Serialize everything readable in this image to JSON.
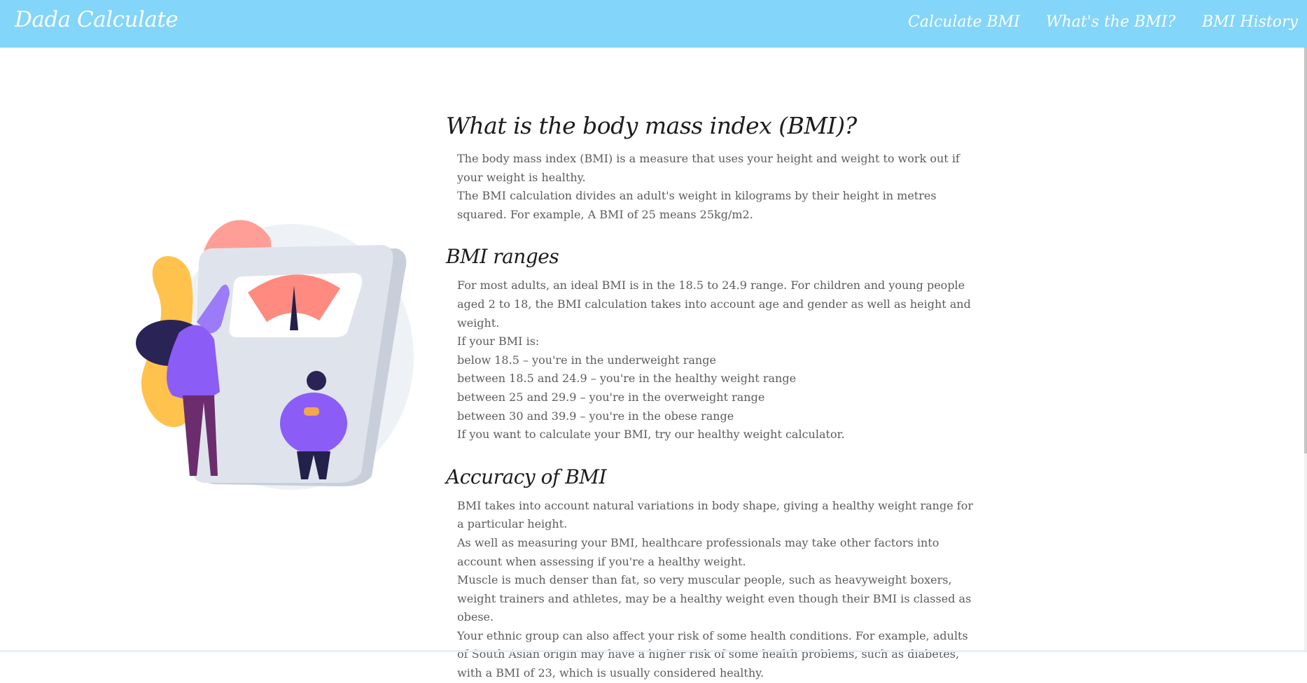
{
  "navbar": {
    "brand": "Dada Calculate",
    "links": [
      "Calculate BMI",
      "What's the BMI?",
      "BMI History"
    ]
  },
  "illustration": {
    "icon": "woman-and-person-on-weighing-scale-illustration",
    "colors": {
      "scale": "#d9dee7",
      "dial": "#ff8a80",
      "leaf_yellow": "#ffc24d",
      "leaf_pink": "#ff9e96",
      "figure_purple": "#8b5cf6",
      "hair": "#2a2356"
    }
  },
  "sections": {
    "intro": {
      "title": "What is the body mass index (BMI)?",
      "lines": [
        "The body mass index (BMI) is a measure that uses your height and weight to work out if your weight is healthy.",
        "The BMI calculation divides an adult's weight in kilograms by their height in metres squared. For example, A BMI of 25 means 25kg/m2."
      ]
    },
    "ranges": {
      "title": "BMI ranges",
      "lines": [
        "For most adults, an ideal BMI is in the 18.5 to 24.9 range. For children and young people aged 2 to 18, the BMI calculation takes into account age and gender as well as height and weight.",
        "If your BMI is:",
        "below 18.5 – you're in the underweight range",
        "between 18.5 and 24.9 – you're in the healthy weight range",
        "between 25 and 29.9 – you're in the overweight range",
        "between 30 and 39.9 – you're in the obese range",
        "If you want to calculate your BMI, try our healthy weight calculator."
      ]
    },
    "accuracy": {
      "title": "Accuracy of BMI",
      "lines": [
        "BMI takes into account natural variations in body shape, giving a healthy weight range for a particular height.",
        "As well as measuring your BMI, healthcare professionals may take other factors into account when assessing if you're a healthy weight.",
        "Muscle is much denser than fat, so very muscular people, such as heavyweight boxers, weight trainers and athletes, may be a healthy weight even though their BMI is classed as obese.",
        "Your ethnic group can also affect your risk of some health conditions. For example, adults of South Asian origin may have a higher risk of some health problems, such as diabetes, with a BMI of 23, which is usually considered healthy."
      ]
    }
  },
  "theme": {
    "navbar_bg": "#83d5f9",
    "nav_text": "#ffffff",
    "heading_text": "#1c1c1c",
    "body_text": "#5c5c5c"
  }
}
